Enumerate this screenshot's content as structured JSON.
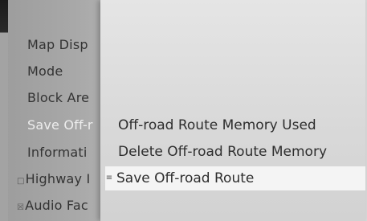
{
  "left_menu": {
    "items": [
      {
        "label": "Map Disp"
      },
      {
        "label": "Mode"
      },
      {
        "label": "Block Are"
      },
      {
        "label": "Save Off-r"
      },
      {
        "label": "Informati"
      },
      {
        "label": "Highway I"
      },
      {
        "label": "Audio Fac"
      }
    ]
  },
  "submenu": {
    "items": [
      {
        "label": "Off-road Route Memory Used"
      },
      {
        "label": "Delete Off-road Route Memory"
      },
      {
        "label": "Save Off-road Route"
      }
    ],
    "selected_index": 2
  },
  "colors": {
    "panel_background": "#dddddd",
    "highlight_background": "#f4f4f4",
    "left_menu_background": "#a6a6a6",
    "selected_text": "#ededed"
  }
}
